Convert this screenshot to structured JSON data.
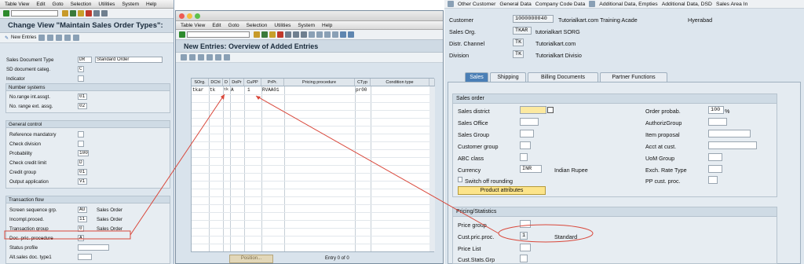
{
  "left": {
    "menu": [
      "Table View",
      "Edit",
      "Goto",
      "Selection",
      "Utilities",
      "System",
      "Help"
    ],
    "title": "Change View \"Maintain Sales Order Types\":",
    "new_entries": "New Entries",
    "fields": {
      "sales_doc_type_label": "Sales Document Type",
      "sales_doc_type_val": "DR",
      "sales_doc_type_desc": "Standard Order",
      "sd_categ_label": "SD document categ.",
      "sd_categ_val": "C",
      "indicator_label": "Indicator"
    },
    "number_systems": {
      "title": "Number systems",
      "int_label": "No.range int.assgt.",
      "int_val": "01",
      "ext_label": "No. range ext. assg.",
      "ext_val": "02"
    },
    "general_control": {
      "title": "General control",
      "ref_mand": "Reference mandatory",
      "check_div": "Check division",
      "probability": "Probability",
      "probability_val": "100",
      "check_credit": "Check credit limit",
      "check_credit_val": "D",
      "credit_group": "Credit group",
      "credit_group_val": "01",
      "output_app": "Output application",
      "output_app_val": "V1"
    },
    "transaction_flow": {
      "title": "Transaction flow",
      "screen_seq": "Screen sequence grp.",
      "screen_seq_val": "AU",
      "screen_seq_desc": "Sales Order",
      "incompl": "Incompl.proced.",
      "incompl_val": "11",
      "incompl_desc": "Sales Order",
      "trans_group": "Transaction group",
      "trans_group_val": "0",
      "trans_group_desc": "Sales Order",
      "doc_pric": "Doc. pric. procedure",
      "doc_pric_val": "A",
      "status_profile": "Status profile",
      "alt_sales": "Alt.sales doc. type1"
    }
  },
  "mid": {
    "menu": [
      "Table View",
      "Edit",
      "Goto",
      "Selection",
      "Utilities",
      "System",
      "Help"
    ],
    "title": "New Entries: Overview of Added Entries",
    "columns": [
      "SOrg.",
      "DChl",
      "D",
      "DoPr",
      "CuPP",
      "PrPr.",
      "Pricing procedure",
      "CTyp",
      "Condition type"
    ],
    "row": [
      "tkar",
      "tk",
      "tk",
      "A",
      "1",
      "RVAA01",
      "",
      "pr00",
      ""
    ],
    "position_btn": "Position...",
    "entry_count": "Entry 0 of 0"
  },
  "right": {
    "menu": [
      "Other Customer",
      "General Data",
      "Company Code Data",
      "Additional Data, Empties",
      "Additional Data, DSD",
      "Sales Area In"
    ],
    "customer_label": "Customer",
    "customer_val": "1000000040",
    "customer_name": "Tutorialkart.com Training Acade",
    "customer_city": "Hyerabad",
    "sales_org_label": "Sales Org.",
    "sales_org_val": "TKAR",
    "sales_org_desc": "tutorialkart SORG",
    "distr_label": "Distr. Channel",
    "distr_val": "TK",
    "distr_desc": "Tutorialkart.com",
    "division_label": "Division",
    "division_val": "TK",
    "division_desc": "Tutorialkart Divisio",
    "tabs": [
      "Sales",
      "Shipping",
      "Billing Documents",
      "Partner Functions"
    ],
    "sales_order": {
      "title": "Sales order",
      "sales_district": "Sales district",
      "sales_office": "Sales Office",
      "sales_group": "Sales Group",
      "customer_group": "Customer group",
      "abc_class": "ABC class",
      "currency": "Currency",
      "currency_val": "INR",
      "currency_desc": "Indian Rupee",
      "switch_off": "Switch off rounding",
      "product_attr": "Product attributes",
      "order_prob": "Order probab.",
      "order_prob_val": "100",
      "order_prob_unit": "%",
      "authoriz": "AuthorizGroup",
      "item_prop": "Item proposal",
      "acct_cust": "Acct at cust.",
      "uom_group": "UoM Group",
      "exch_rate": "Exch. Rate Type",
      "pp_cust": "PP cust. proc."
    },
    "pricing": {
      "title": "Pricing/Statistics",
      "price_group": "Price group",
      "cust_pric": "Cust.pric.proc.",
      "cust_pric_val": "1",
      "cust_pric_desc": "Standard",
      "price_list": "Price List",
      "cust_stats": "Cust.Stats.Grp"
    }
  },
  "colors": {
    "annotation": "#d9473a",
    "highlight": "#fce9a0",
    "active_tab": "#4a7fb6"
  }
}
